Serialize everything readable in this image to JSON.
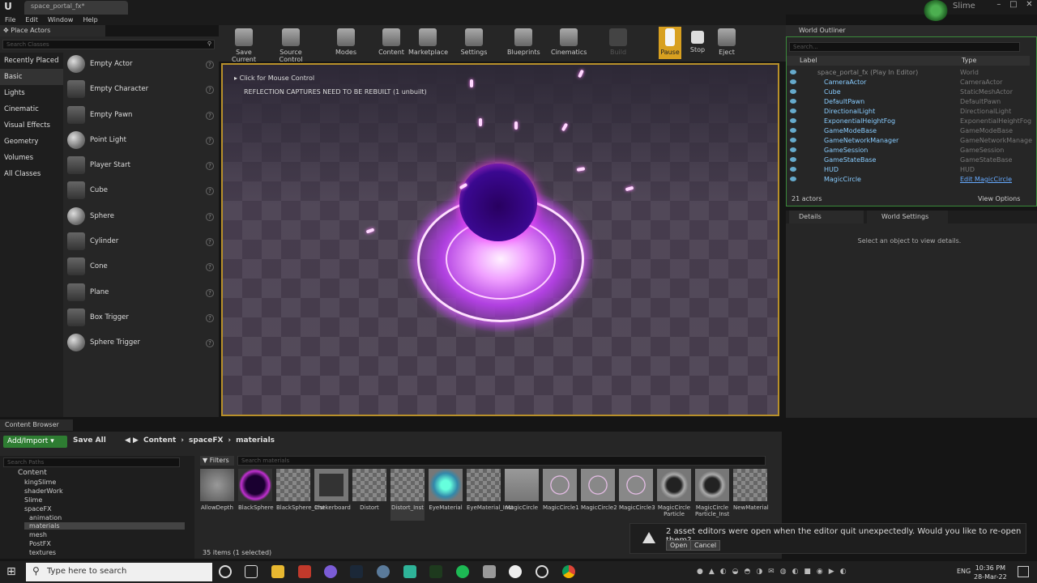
{
  "titlebar": {
    "doc_tab": "space_portal_fx*",
    "user_name": "Slime"
  },
  "menu": [
    "File",
    "Edit",
    "Window",
    "Help"
  ],
  "place_actors": {
    "tab": "Place Actors",
    "search_placeholder": "Search Classes",
    "categories": [
      "Recently Placed",
      "Basic",
      "Lights",
      "Cinematic",
      "Visual Effects",
      "Geometry",
      "Volumes",
      "All Classes"
    ],
    "selected_category": "Basic",
    "items": [
      "Empty Actor",
      "Empty Character",
      "Empty Pawn",
      "Point Light",
      "Player Start",
      "Cube",
      "Sphere",
      "Cylinder",
      "Cone",
      "Plane",
      "Box Trigger",
      "Sphere Trigger"
    ]
  },
  "toolbar": [
    "Save Current",
    "Source Control",
    "Modes",
    "Content",
    "Marketplace",
    "Settings",
    "Blueprints",
    "Cinematics",
    "Build",
    "Pause",
    "Stop",
    "Eject"
  ],
  "viewport": {
    "mouse_hint": "Click for Mouse Control",
    "warning": "REFLECTION CAPTURES NEED TO BE REBUILT (1 unbuilt)"
  },
  "outliner": {
    "tab": "World Outliner",
    "search_placeholder": "Search...",
    "col_label": "Label",
    "col_type": "Type",
    "root_label": "space_portal_fx (Play In Editor)",
    "root_type": "World",
    "rows": [
      {
        "label": "CameraActor",
        "type": "CameraActor"
      },
      {
        "label": "Cube",
        "type": "StaticMeshActor"
      },
      {
        "label": "DefaultPawn",
        "type": "DefaultPawn"
      },
      {
        "label": "DirectionalLight",
        "type": "DirectionalLight"
      },
      {
        "label": "ExponentialHeightFog",
        "type": "ExponentialHeightFog"
      },
      {
        "label": "GameModeBase",
        "type": "GameModeBase"
      },
      {
        "label": "GameNetworkManager",
        "type": "GameNetworkManage"
      },
      {
        "label": "GameSession",
        "type": "GameSession"
      },
      {
        "label": "GameStateBase",
        "type": "GameStateBase"
      },
      {
        "label": "HUD",
        "type": "HUD"
      },
      {
        "label": "MagicCircle",
        "type": "Edit MagicCircle"
      }
    ],
    "count": "21 actors",
    "view_options": "View Options"
  },
  "details": {
    "tab_details": "Details",
    "tab_world": "World Settings",
    "empty": "Select an object to view details."
  },
  "content_browser": {
    "tab": "Content Browser",
    "add_import": "Add/Import",
    "save_all": "Save All",
    "path": [
      "Content",
      "spaceFX",
      "materials"
    ],
    "tree_search": "Search Paths",
    "tree": [
      "Content",
      "kingSlime",
      "shaderWork",
      "Slime",
      "spaceFX",
      "animation",
      "materials",
      "mesh",
      "PostFX",
      "textures"
    ],
    "filters": "Filters",
    "asset_search": "Search materials",
    "assets": [
      "AllowDepth",
      "BlackSphere",
      "BlackSphere_Inst",
      "Chekerboard",
      "Distort",
      "Distort_Inst",
      "EyeMaterial",
      "EyeMaterial_Inst",
      "MagicCircle",
      "MagicCircle1",
      "MagicCircle2",
      "MagicCircle3",
      "MagicCircle Particle",
      "MagicCircle Particle_Inst",
      "NewMaterial"
    ],
    "count": "35 items (1 selected)"
  },
  "notification": {
    "message": "2 asset editors were open when the editor quit unexpectedly. Would you like to re-open them?",
    "open": "Open",
    "cancel": "Cancel"
  },
  "taskbar": {
    "search": "Type here to search",
    "lang": "ENG",
    "time": "10:36 PM",
    "date": "28-Mar-22"
  }
}
